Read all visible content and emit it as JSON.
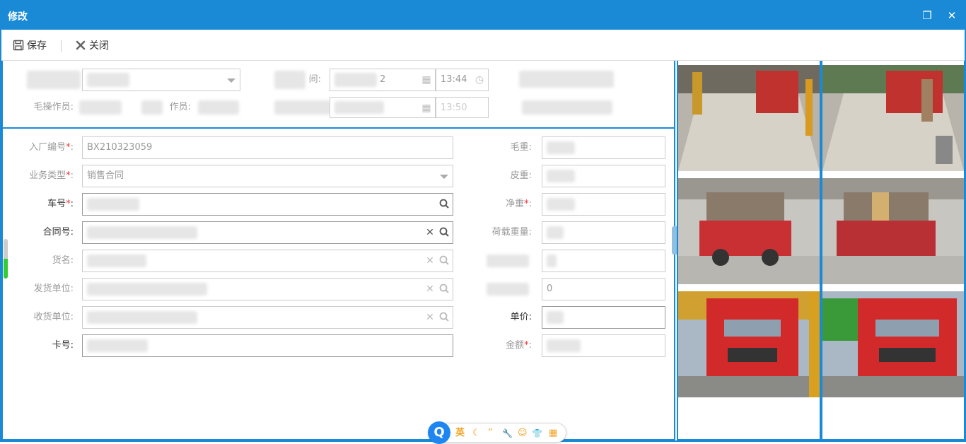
{
  "window": {
    "title": "修改",
    "restore_label": "❐",
    "close_label": "✕"
  },
  "toolbar": {
    "save_label": "保存",
    "close_label": "关闭"
  },
  "top_panel": {
    "time_value": "13:44",
    "gross_operator_label": "毛操作员:",
    "tare_operator_label": "作员:",
    "time_label_fragment": "间:",
    "blur_time_fragment": "2",
    "time2_fragment": "13:50"
  },
  "form": {
    "entry_no": {
      "label": "入厂编号",
      "value": "BX210323059",
      "required": true
    },
    "biz_type": {
      "label": "业务类型",
      "value": "销售合同",
      "required": true
    },
    "plate_no": {
      "label": "车号",
      "value": "",
      "required": true
    },
    "contract_no": {
      "label": "合同号",
      "value": ""
    },
    "goods_name": {
      "label": "货名",
      "value": ""
    },
    "shipper": {
      "label": "发货单位",
      "value": ""
    },
    "receiver": {
      "label": "收货单位",
      "value": ""
    },
    "card_no": {
      "label": "卡号",
      "value": ""
    },
    "gross_weight": {
      "label": "毛重",
      "value": ""
    },
    "tare_weight": {
      "label": "皮重",
      "value": ""
    },
    "net_weight": {
      "label": "净重",
      "value": "",
      "required": true
    },
    "load_weight": {
      "label": "荷载重量",
      "value": ""
    },
    "blurred_field_value": "0",
    "unit_price": {
      "label": "单价",
      "value": ""
    },
    "amount": {
      "label": "金额",
      "value": "",
      "required": true
    }
  },
  "ime": {
    "logo": "Q",
    "mode": "英",
    "items": [
      "☾",
      "”",
      "🔧",
      "☺",
      "👕",
      "▦"
    ]
  },
  "colors": {
    "accent": "#1a8ad6",
    "required": "#e33333",
    "truck_red": "#d22a2a"
  }
}
